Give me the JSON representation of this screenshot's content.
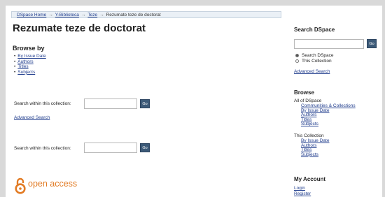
{
  "breadcrumb": {
    "items": [
      "DSpace Home",
      "Y-Biblioteca",
      "Teze"
    ],
    "separator": "→",
    "current": "Rezumate teze de doctorat"
  },
  "main": {
    "title": "Rezumate teze de doctorat",
    "browse_by": {
      "heading": "Browse by",
      "items": [
        "By Issue Date",
        "Authors",
        "Titles",
        "Subjects"
      ]
    },
    "search_top": {
      "label": "Search within this collection:",
      "value": "",
      "button": "Go"
    },
    "advanced_search": "Advanced Search",
    "search_bottom": {
      "label": "Search within this collection:",
      "value": "",
      "button": "Go"
    },
    "open_access": {
      "text": "open access",
      "color": "#e27b24"
    }
  },
  "sidebar": {
    "search": {
      "heading": "Search DSpace",
      "value": "",
      "button": "Go",
      "options": [
        {
          "label": "Search DSpace",
          "selected": true
        },
        {
          "label": "This Collection",
          "selected": false
        }
      ],
      "advanced": "Advanced Search"
    },
    "browse": {
      "heading": "Browse",
      "all_label": "All of DSpace",
      "all_items": [
        "Communities & Collections",
        "By Issue Date",
        "Authors",
        "Titles",
        "Subjects"
      ],
      "collection_label": "This Collection",
      "collection_items": [
        "By Issue Date",
        "Authors",
        "Titles",
        "Subjects"
      ]
    },
    "account": {
      "heading": "My Account",
      "items": [
        "Login",
        "Register"
      ]
    }
  },
  "colors": {
    "link": "#24408f",
    "button": "#3c5a78",
    "breadcrumb_bg": "#eaf0f6"
  }
}
